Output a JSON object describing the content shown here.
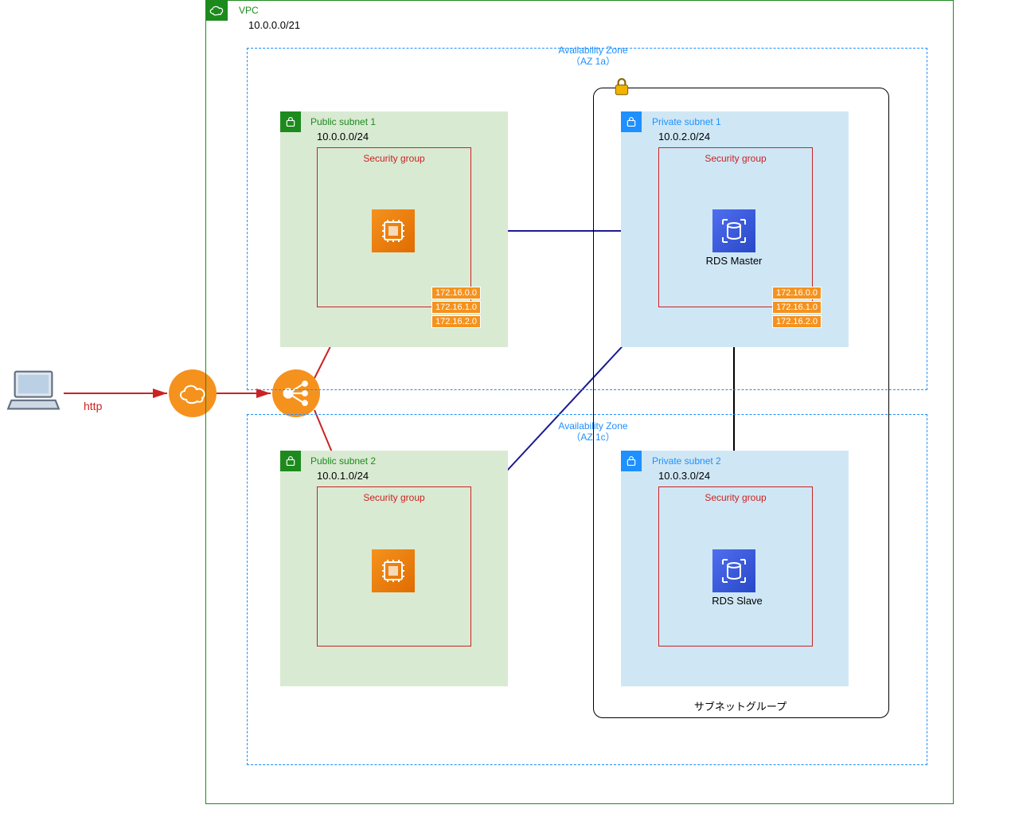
{
  "http_label": "http",
  "vpc": {
    "title": "VPC",
    "cidr": "10.0.0.0/21"
  },
  "az1": {
    "title": "Availability Zone\n（AZ 1a）"
  },
  "az2": {
    "title": "Availability Zone\n（AZ 1c）"
  },
  "public1": {
    "title": "Public subnet 1",
    "cidr": "10.0.0.0/24",
    "sg": "Security group",
    "ips": [
      "172.16.0.0",
      "172.16.1.0",
      "172.16.2.0"
    ]
  },
  "public2": {
    "title": "Public subnet 2",
    "cidr": "10.0.1.0/24",
    "sg": "Security group"
  },
  "private1": {
    "title": "Private subnet 1",
    "cidr": "10.0.2.0/24",
    "sg": "Security group",
    "ips": [
      "172.16.0.0",
      "172.16.1.0",
      "172.16.2.0"
    ]
  },
  "private2": {
    "title": "Private subnet 2",
    "cidr": "10.0.3.0/24",
    "sg": "Security group"
  },
  "rds_master": "RDS Master",
  "rds_slave": "RDS Slave",
  "subnet_group": "サブネットグループ",
  "colors": {
    "green": "#1d8a1d",
    "blue": "#1e90ff",
    "orange": "#f5921e",
    "red": "#cc2222",
    "db": "#2848c8"
  }
}
